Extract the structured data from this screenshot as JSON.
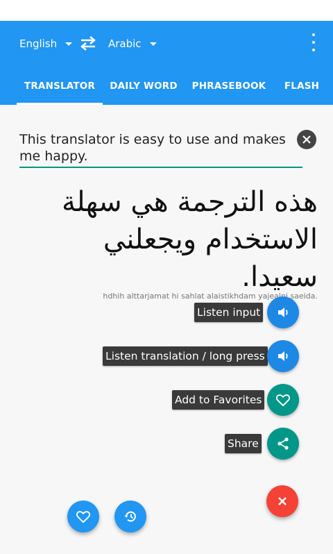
{
  "header": {
    "source_lang": "English",
    "target_lang": "Arabic",
    "tabs": [
      {
        "label": "TRANSLATOR",
        "active": true
      },
      {
        "label": "DAILY WORD",
        "active": false
      },
      {
        "label": "PHRASEBOOK",
        "active": false
      },
      {
        "label": "FLASH",
        "active": false
      }
    ]
  },
  "translator": {
    "input_text": "This translator is easy to use and makes me happy.",
    "translation": "هذه الترجمة هي سهلة الاستخدام ويجعلني سعيدا.",
    "transliteration": "hdhih alttarjamat hi sahlat alaistikhdam yajealni saeida."
  },
  "actions": {
    "listen_input": "Listen input",
    "listen_translation": "Listen translation / long press",
    "add_favorites": "Add to Favorites",
    "share": "Share"
  },
  "colors": {
    "primary": "#2196f3",
    "accent_teal": "#009688",
    "fab_red": "#f44336",
    "label_bg": "#3a3a3a"
  }
}
